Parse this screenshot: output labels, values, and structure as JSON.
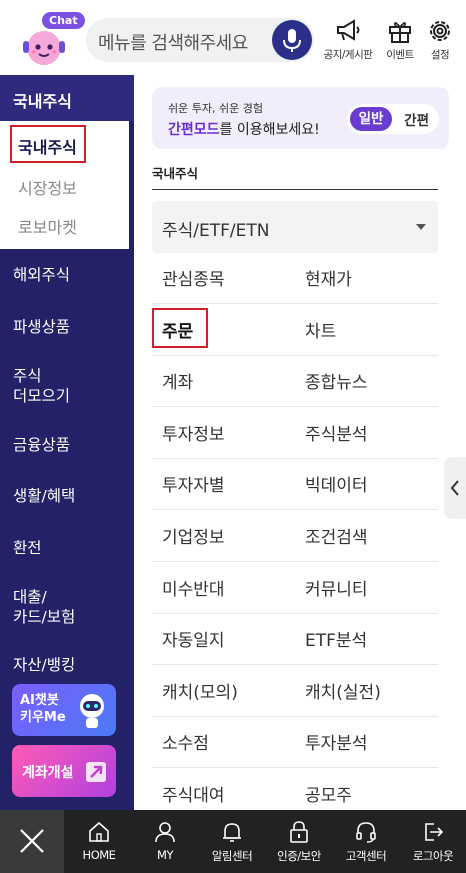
{
  "header": {
    "chat_badge": "Chat",
    "search_placeholder": "메뉴를 검색해주세요",
    "buttons": [
      {
        "label": "공지/게시판",
        "icon": "megaphone-icon"
      },
      {
        "label": "이벤트",
        "icon": "gift-icon"
      },
      {
        "label": "설정",
        "icon": "gear-icon"
      }
    ]
  },
  "leftnav": {
    "active_section": "국내주식",
    "sub_items": [
      "국내주식",
      "시장정보",
      "로보마켓"
    ],
    "items": [
      "해외주식",
      "파생상품",
      "주식\n더모으기",
      "금융상품",
      "생활/혜택",
      "환전",
      "대출/\n카드/보험",
      "자산/뱅킹"
    ],
    "promo_ai": "AI챗봇\n키우Me",
    "promo_account": "계좌개설"
  },
  "banner": {
    "sub": "쉬운 투자, 쉬운 경험",
    "main_highlight": "간편모드",
    "main_rest": "를 이용해보세요!",
    "toggle_on": "일반",
    "toggle_off": "간편"
  },
  "section": {
    "title": "국내주식",
    "select_value": "주식/ETF/ETN"
  },
  "menu": [
    [
      "관심종목",
      "현재가"
    ],
    [
      "주문",
      "차트"
    ],
    [
      "계좌",
      "종합뉴스"
    ],
    [
      "투자정보",
      "주식분석"
    ],
    [
      "투자자별",
      "빅데이터"
    ],
    [
      "기업정보",
      "조건검색"
    ],
    [
      "미수반대",
      "커뮤니티"
    ],
    [
      "자동일지",
      "ETF분석"
    ],
    [
      "캐치(모의)",
      "캐치(실전)"
    ],
    [
      "소수점",
      "투자분석"
    ],
    [
      "주식대여",
      "공모주"
    ]
  ],
  "bottombar": {
    "tabs": [
      {
        "label": "HOME",
        "icon": "home-icon"
      },
      {
        "label": "MY",
        "icon": "person-icon"
      },
      {
        "label": "알림센터",
        "icon": "bell-icon"
      },
      {
        "label": "인증/보안",
        "icon": "lock-icon"
      },
      {
        "label": "고객센터",
        "icon": "headset-icon"
      },
      {
        "label": "로그아웃",
        "icon": "logout-icon"
      }
    ]
  },
  "colors": {
    "nav_bg": "#232167",
    "accent_purple": "#6a3ccf",
    "highlight_red": "#d0202a"
  }
}
